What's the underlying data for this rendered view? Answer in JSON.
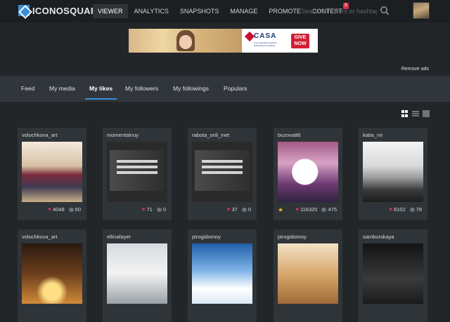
{
  "app": {
    "logo_text": "ICONOSQUARE",
    "accent_color": "#3b8fd9"
  },
  "nav": {
    "items": [
      {
        "label": "VIEWER",
        "active": true
      },
      {
        "label": "ANALYTICS"
      },
      {
        "label": "SNAPSHOTS"
      },
      {
        "label": "MANAGE"
      },
      {
        "label": "PROMOTE"
      },
      {
        "label": "CONTEST",
        "badge": "5"
      }
    ]
  },
  "search": {
    "placeholder": "Search for users or hashtags",
    "value": "",
    "icon": "search-icon"
  },
  "ad": {
    "brand": "CASA",
    "sub": "Court Appointed Special Advocates for Children",
    "cta_line1": "GIVE",
    "cta_line2": "NOW",
    "remove_label": "Remove ads"
  },
  "tabs": [
    {
      "label": "Feed"
    },
    {
      "label": "My media"
    },
    {
      "label": "My likes",
      "active": true
    },
    {
      "label": "My followers"
    },
    {
      "label": "My followings"
    },
    {
      "label": "Populars"
    }
  ],
  "view_modes": [
    "grid-view",
    "list-view",
    "tile-view"
  ],
  "cards_row1": [
    {
      "user": "volochkova_art",
      "likes": "4048",
      "comments": "60",
      "photo": "ballet"
    },
    {
      "user": "momentalnuy",
      "likes": "71",
      "comments": "0",
      "photo": "poster"
    },
    {
      "user": "rabota_onli_inet",
      "likes": "37",
      "comments": "0",
      "photo": "poster"
    },
    {
      "user": "buzova86",
      "likes": "116320",
      "comments": "475",
      "photo": "bride",
      "starred": true
    },
    {
      "user": "katia_mi",
      "likes": "8102",
      "comments": "78",
      "photo": "tree"
    }
  ],
  "cards_row2": [
    {
      "user": "volochkova_art",
      "photo": "candle"
    },
    {
      "user": "ellinafayer",
      "photo": "dress"
    },
    {
      "user": "pirogidomoy",
      "photo": "church"
    },
    {
      "user": "pirogidomoy",
      "photo": "bears"
    },
    {
      "user": "samburskaya",
      "photo": "dark"
    }
  ]
}
